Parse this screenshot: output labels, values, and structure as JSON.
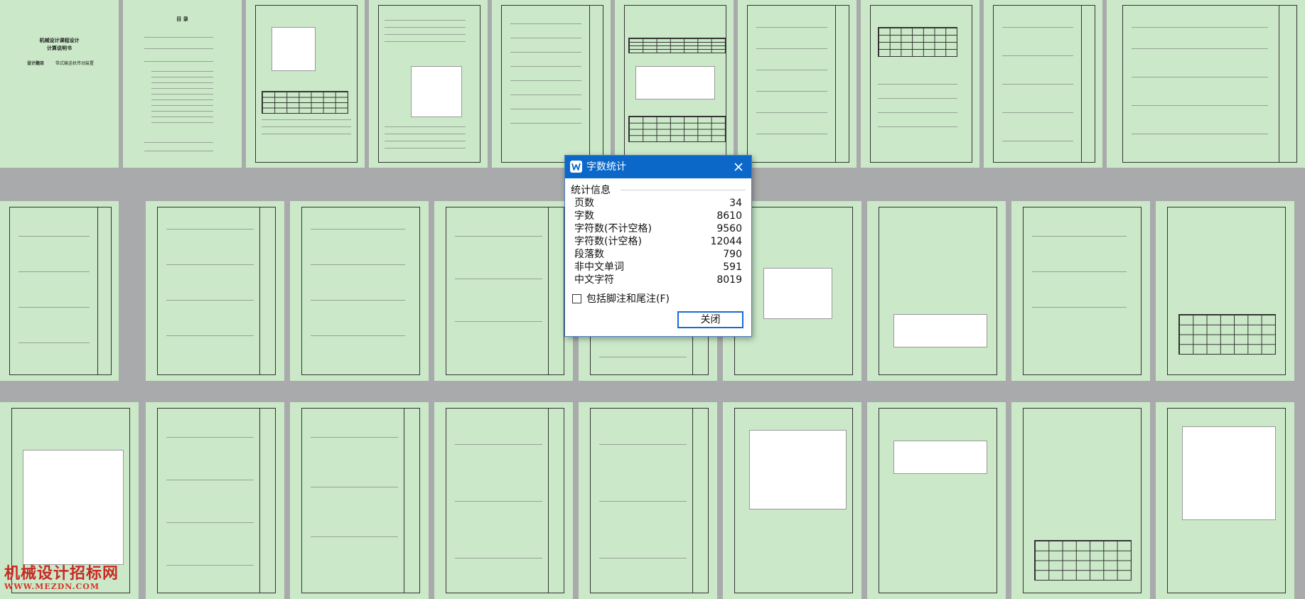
{
  "document": {
    "cover": {
      "title_line1": "机械设计课程设计",
      "title_line2": "计算说明书",
      "design_title_label": "设计题目",
      "design_title_value": "带式输送机传动装置"
    },
    "toc": {
      "heading": "目  录"
    }
  },
  "dialog": {
    "title": "字数统计",
    "app_icon": "wps-writer-icon",
    "close_icon": "close-icon",
    "section_label": "统计信息",
    "stats": [
      {
        "label": "页数",
        "value": "34"
      },
      {
        "label": "字数",
        "value": "8610"
      },
      {
        "label": "字符数(不计空格)",
        "value": "9560"
      },
      {
        "label": "字符数(计空格)",
        "value": "12044"
      },
      {
        "label": "段落数",
        "value": "790"
      },
      {
        "label": "非中文单词",
        "value": "591"
      },
      {
        "label": "中文字符",
        "value": "8019"
      }
    ],
    "include_footnotes_label": "包括脚注和尾注(F)",
    "include_footnotes_checked": false,
    "close_button_label": "关闭"
  },
  "watermark": {
    "text": "机械设计招标网",
    "url": "WWW.MEZDN.COM"
  },
  "colors": {
    "page_background": "#cbe9c8",
    "workspace_background": "#a9aaab",
    "titlebar": "#0b68c9",
    "watermark": "#c92a25"
  }
}
